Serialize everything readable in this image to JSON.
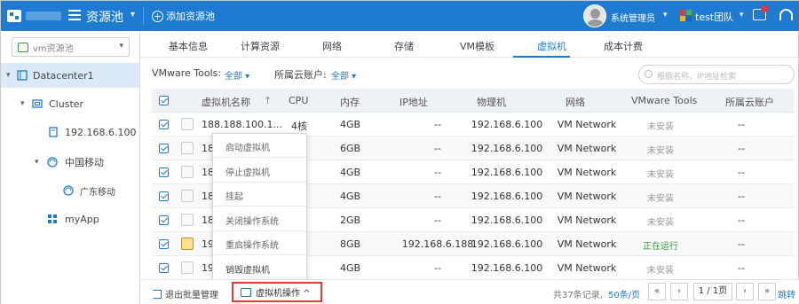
{
  "header": {
    "title": "资源池",
    "add_pool_label": "添加资源池",
    "user_name": "系统管理员",
    "team_name": "test团队"
  },
  "sidebar": {
    "pool_select_value": "vm资源池",
    "tree": [
      {
        "label": "Datacenter1",
        "icon": "datacenter-icon",
        "selected": true
      },
      {
        "label": "Cluster",
        "icon": "cluster-icon"
      },
      {
        "label": "192.168.6.100",
        "icon": "host-icon"
      },
      {
        "label": "中国移动",
        "icon": "resource-pool-icon"
      },
      {
        "label": "广东移动",
        "icon": "resource-pool-icon"
      },
      {
        "label": "myApp",
        "icon": "app-grid-icon"
      }
    ]
  },
  "tabs": [
    "基本信息",
    "计算资源",
    "网络",
    "存储",
    "VM模板",
    "虚拟机",
    "成本计费"
  ],
  "active_tab": "虚拟机",
  "filters": {
    "vmware_tools_label": "VMware Tools:",
    "vmware_tools_value": "全部",
    "cloud_account_label": "所属云账户:",
    "cloud_account_value": "全部",
    "search_placeholder": "根据名称、IP地址检索"
  },
  "table": {
    "columns": [
      "虚拟机名称",
      "CPU",
      "内存",
      "IP地址",
      "物理机",
      "网络",
      "VMware Tools",
      "所属云账户"
    ],
    "sort_indicator": "↑",
    "rows": [
      {
        "name": "188.188.100.1...",
        "cpu": "4核",
        "mem": "4GB",
        "ip": "--",
        "host": "192.168.6.100",
        "net": "VM Network",
        "tools": "未安装",
        "account": "--",
        "os": "windows"
      },
      {
        "name": "188",
        "cpu": "",
        "mem": "6GB",
        "ip": "--",
        "host": "192.168.6.100",
        "net": "VM Network",
        "tools": "未安装",
        "account": "--",
        "os": "windows"
      },
      {
        "name": "188",
        "cpu": "",
        "mem": "4GB",
        "ip": "--",
        "host": "192.168.6.100",
        "net": "VM Network",
        "tools": "未安装",
        "account": "--",
        "os": "windows"
      },
      {
        "name": "188",
        "cpu": "",
        "mem": "4GB",
        "ip": "--",
        "host": "192.168.6.100",
        "net": "VM Network",
        "tools": "未安装",
        "account": "--",
        "os": "windows"
      },
      {
        "name": "188",
        "cpu": "",
        "mem": "2GB",
        "ip": "--",
        "host": "192.168.6.100",
        "net": "VM Network",
        "tools": "未安装",
        "account": "--",
        "os": "windows"
      },
      {
        "name": "19",
        "cpu": "",
        "mem": "8GB",
        "ip": "192.168.6.188",
        "host": "192.168.6.100",
        "net": "VM Network",
        "tools": "正在运行",
        "account": "--",
        "os": "linux"
      },
      {
        "name": "19",
        "cpu": "",
        "mem": "4GB",
        "ip": "--",
        "host": "192.168.6.100",
        "net": "VM Network",
        "tools": "未安装",
        "account": "--",
        "os": "windows"
      }
    ]
  },
  "context_menu": [
    "启动虚拟机",
    "停止虚拟机",
    "挂起",
    "关闭操作系统",
    "重启操作系统",
    "销毁虚拟机"
  ],
  "footer": {
    "exit_batch_label": "退出批量管理",
    "vm_op_label": "虚拟机操作 ^",
    "total_label": "共37条记录,",
    "per_page_label": "50条/页",
    "page_label": "1 / 1页",
    "jump_label": "跳转",
    "first_label": "«",
    "prev_label": "‹",
    "next_label": "›",
    "last_label": "»"
  },
  "colors": {
    "brand": "#1f7bd1",
    "danger": "#e53935",
    "running": "#3c9a3c"
  }
}
